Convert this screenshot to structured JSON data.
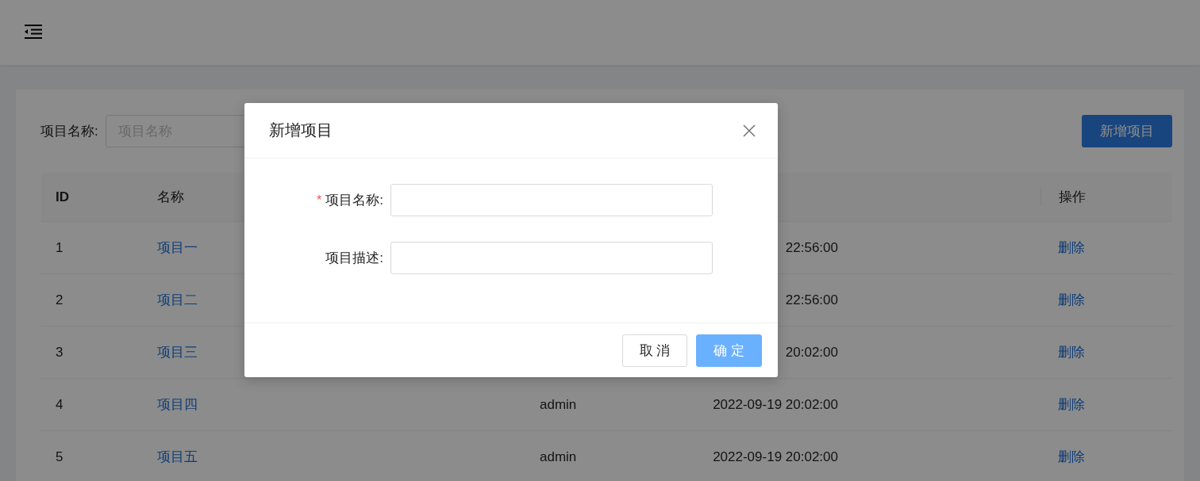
{
  "filter": {
    "label": "项目名称:",
    "placeholder": "项目名称"
  },
  "add_button": "新增项目",
  "table": {
    "header": {
      "id": "ID",
      "name": "名称",
      "action": "操作"
    },
    "rows": [
      {
        "id": "1",
        "name": "项目一",
        "time": "22:56:00",
        "action": "删除"
      },
      {
        "id": "2",
        "name": "项目二",
        "time": "22:56:00",
        "action": "删除"
      },
      {
        "id": "3",
        "name": "项目三",
        "time": "20:02:00",
        "action": "删除"
      },
      {
        "id": "4",
        "name": "项目四",
        "creator": "admin",
        "time": "2022-09-19 20:02:00",
        "action": "删除"
      },
      {
        "id": "5",
        "name": "项目五",
        "creator": "admin",
        "time": "2022-09-19 20:02:00",
        "action": "删除"
      }
    ]
  },
  "modal": {
    "title": "新增项目",
    "fields": [
      {
        "label": "项目名称:",
        "required_mark": "*"
      },
      {
        "label": "项目描述:"
      }
    ],
    "buttons": [
      {
        "label": "取 消",
        "kind": "default"
      },
      {
        "label": "确 定",
        "kind": "primary"
      }
    ]
  }
}
